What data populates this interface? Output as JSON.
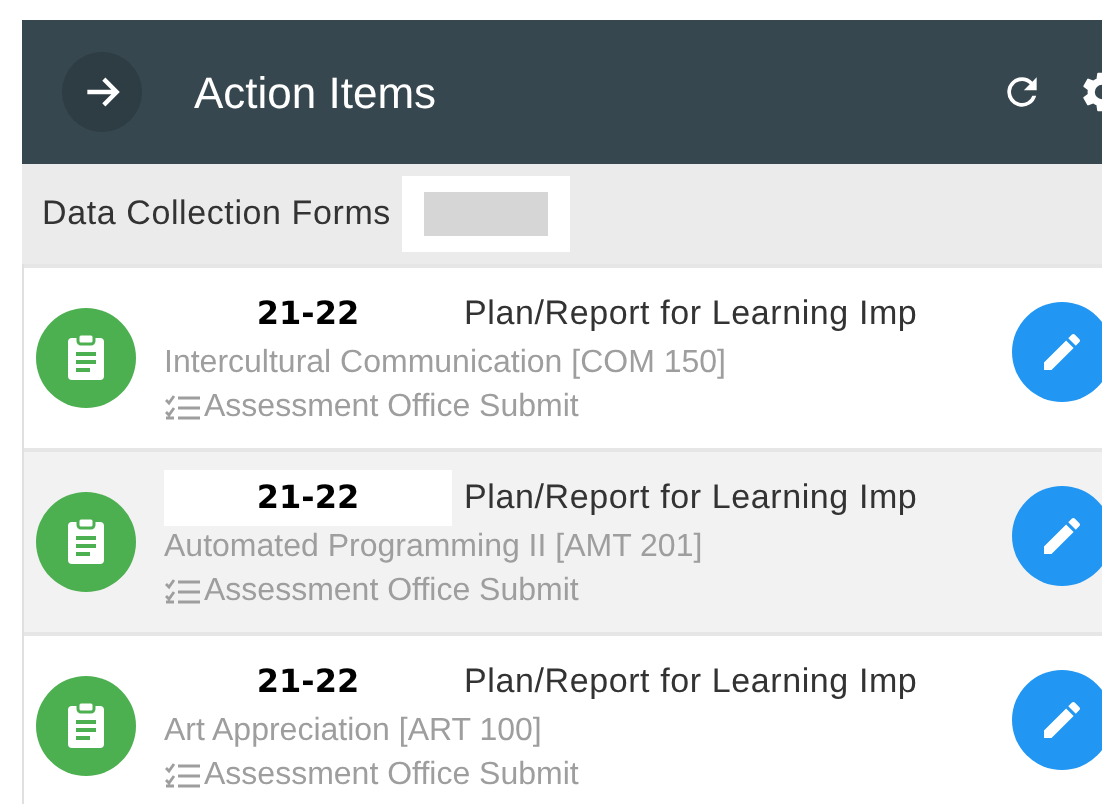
{
  "header": {
    "title": "Action Items"
  },
  "section": {
    "title": "Data Collection Forms"
  },
  "items": [
    {
      "year": "21-22",
      "title": "Plan/Report for Learning Imp",
      "course": "Intercultural Communication [COM 150]",
      "step": "Assessment Office Submit",
      "highlighted": false
    },
    {
      "year": "21-22",
      "title": "Plan/Report for Learning Imp",
      "course": "Automated Programming II [AMT 201]",
      "step": "Assessment Office Submit",
      "highlighted": true
    },
    {
      "year": "21-22",
      "title": "Plan/Report for Learning Imp",
      "course": "Art Appreciation [ART 100]",
      "step": "Assessment Office Submit",
      "highlighted": false
    }
  ]
}
